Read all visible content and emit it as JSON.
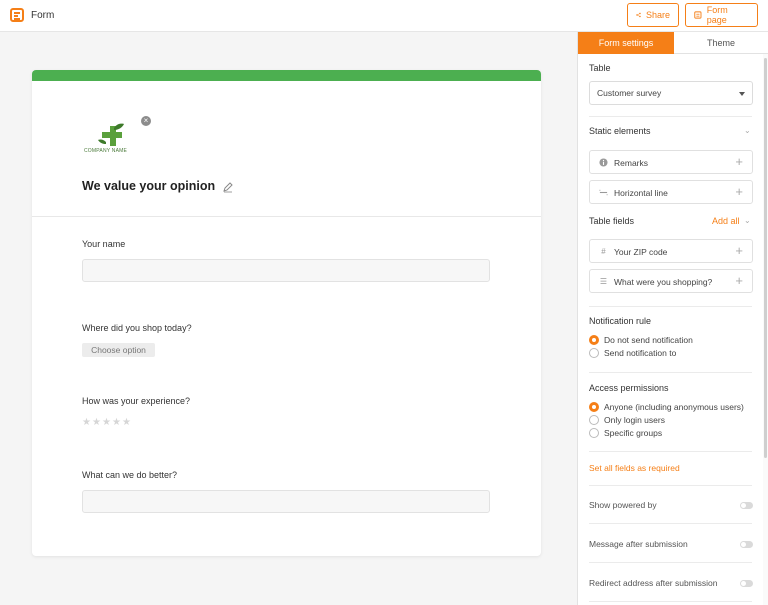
{
  "header": {
    "title": "Form",
    "share_label": "Share",
    "form_page_label": "Form page",
    "accent_color": "#f57f17"
  },
  "form": {
    "header_color": "#4caf50",
    "logo_text": "COMPANY NAME",
    "title": "We value your opinion",
    "questions": [
      {
        "label": "Your name",
        "type": "text"
      },
      {
        "label": "Where did you shop today?",
        "type": "select",
        "placeholder": "Choose option"
      },
      {
        "label": "How was your experience?",
        "type": "rating",
        "stars": 5
      },
      {
        "label": "What can we do better?",
        "type": "text"
      }
    ]
  },
  "panel": {
    "tabs": [
      "Form settings",
      "Theme"
    ],
    "table_label": "Table",
    "table_value": "Customer survey",
    "static_elements_label": "Static elements",
    "static_elements": [
      {
        "label": "Remarks",
        "icon": "info-icon"
      },
      {
        "label": "Horizontal line",
        "icon": "horizontal-line-icon"
      }
    ],
    "table_fields_label": "Table fields",
    "add_all_label": "Add all",
    "table_fields": [
      {
        "label": "Your ZIP code",
        "icon": "hash-icon"
      },
      {
        "label": "What were you shopping?",
        "icon": "list-icon"
      }
    ],
    "notification_label": "Notification rule",
    "notification_options": [
      {
        "label": "Do not send notification",
        "selected": true
      },
      {
        "label": "Send notification to",
        "selected": false
      }
    ],
    "access_label": "Access permissions",
    "access_options": [
      {
        "label": "Anyone (including anonymous users)",
        "selected": true
      },
      {
        "label": "Only login users",
        "selected": false
      },
      {
        "label": "Specific groups",
        "selected": false
      }
    ],
    "required_link": "Set all fields as required",
    "toggles": [
      {
        "label": "Show powered by",
        "on": false
      },
      {
        "label": "Message after submission",
        "on": false
      },
      {
        "label": "Redirect address after submission",
        "on": false
      }
    ]
  }
}
